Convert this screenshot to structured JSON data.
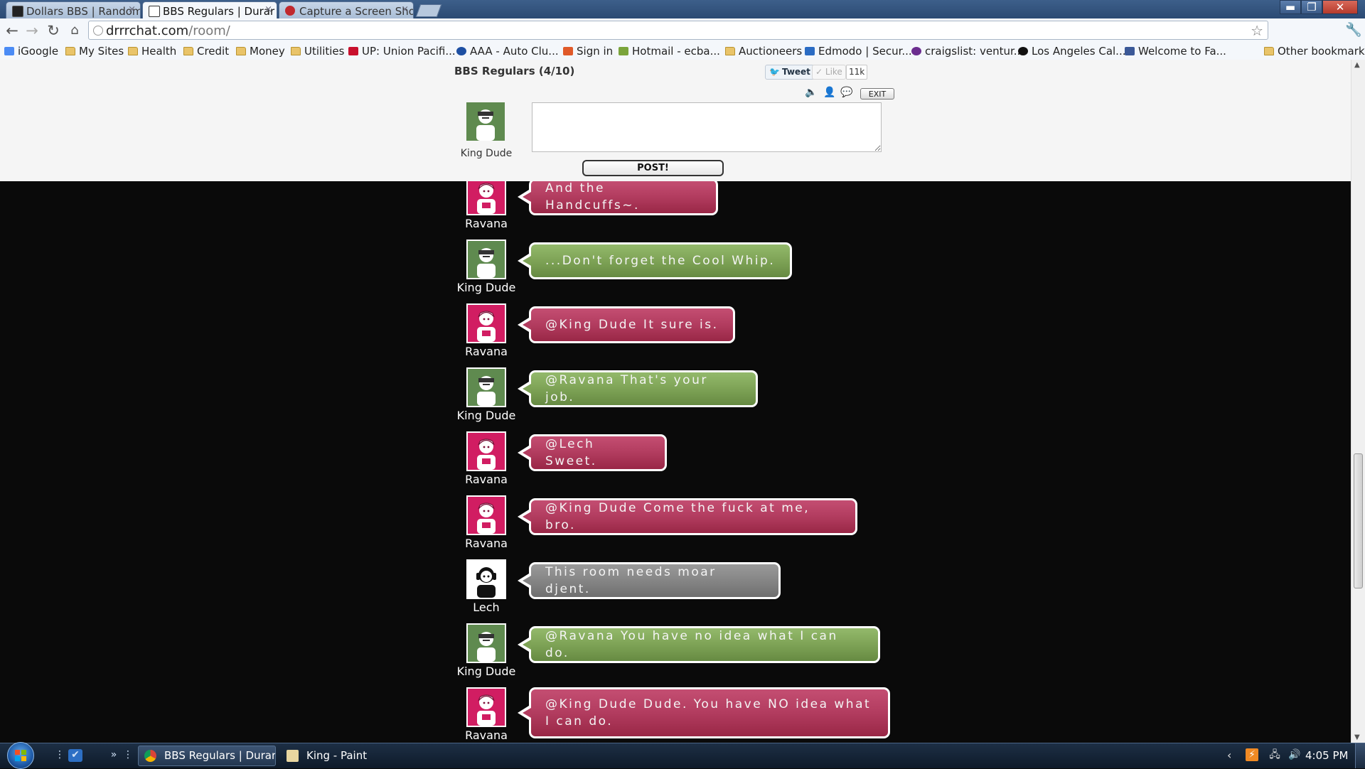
{
  "browser": {
    "tabs": [
      {
        "label": "Dollars BBS | Random",
        "icon_color": "#222222"
      },
      {
        "label": "BBS Regulars | Durar",
        "icon_color": "#333333"
      },
      {
        "label": "Capture a Screen Sho",
        "icon_color": "#c0282d"
      }
    ],
    "url_host": "drrrchat.com",
    "url_path": "/room/",
    "window_controls": {
      "minimize": "▬",
      "restore": "❐",
      "close": "✕"
    },
    "icons": {
      "back": "back-arrow-icon",
      "forward": "forward-arrow-icon",
      "reload": "reload-icon",
      "home": "home-icon",
      "star": "star-icon",
      "wrench": "wrench-icon"
    }
  },
  "bookmarks": [
    {
      "label": "iGoogle",
      "icon": "igoogle-icon",
      "color": "#4a8bf5"
    },
    {
      "label": "My Sites",
      "icon": "folder-icon",
      "color": "#e9c46a"
    },
    {
      "label": "Health",
      "icon": "folder-icon",
      "color": "#e9c46a"
    },
    {
      "label": "Credit",
      "icon": "folder-icon",
      "color": "#e9c46a"
    },
    {
      "label": "Money",
      "icon": "folder-icon",
      "color": "#e9c46a"
    },
    {
      "label": "Utilities",
      "icon": "folder-icon",
      "color": "#e9c46a"
    },
    {
      "label": "UP: Union Pacifi...",
      "icon": "union-pacific-icon",
      "color": "#c8102e"
    },
    {
      "label": "AAA - Auto Clu...",
      "icon": "aaa-icon",
      "color": "#1d4fa3"
    },
    {
      "label": "Sign in",
      "icon": "msn-icon",
      "color": "#e05a2a"
    },
    {
      "label": "Hotmail - ecba...",
      "icon": "hotmail-icon",
      "color": "#7aa43c"
    },
    {
      "label": "Auctioneers",
      "icon": "folder-icon",
      "color": "#e9c46a"
    },
    {
      "label": "Edmodo | Secur...",
      "icon": "edmodo-icon",
      "color": "#2b6cc4"
    },
    {
      "label": "craigslist: ventur...",
      "icon": "peace-icon",
      "color": "#6b2d8f"
    },
    {
      "label": "Los Angeles Cal...",
      "icon": "la-icon",
      "color": "#111111"
    },
    {
      "label": "Welcome to Fa...",
      "icon": "facebook-icon",
      "color": "#3b5998"
    }
  ],
  "other_bookmarks": "Other bookmarks",
  "room": {
    "title": "BBS Regulars (4/10)",
    "tweet_label": "Tweet",
    "like_label": "Like",
    "like_count": "11k",
    "exit_label": "EXIT",
    "post_label": "POST!",
    "current_user": "King Dude",
    "post_text": "",
    "controls": [
      "speaker-icon",
      "user-icon",
      "speech-bubble-icon"
    ]
  },
  "user_colors": {
    "King Dude": "#5f8a4f",
    "Ravana": "#d11d62",
    "Lech": "#ffffff"
  },
  "messages": [
    {
      "user": "Ravana",
      "text": "And the Handcuffs~.",
      "color": "pink"
    },
    {
      "user": "King Dude",
      "text": "...Don't forget the Cool Whip.",
      "color": "green"
    },
    {
      "user": "Ravana",
      "text": "@King Dude It sure is.",
      "color": "pink"
    },
    {
      "user": "King Dude",
      "text": "@Ravana That's your job.",
      "color": "green"
    },
    {
      "user": "Ravana",
      "text": "@Lech Sweet.",
      "color": "pink"
    },
    {
      "user": "Ravana",
      "text": "@King Dude Come the fuck at me, bro.",
      "color": "pink"
    },
    {
      "user": "Lech",
      "text": "This room needs moar djent.",
      "color": "gray"
    },
    {
      "user": "King Dude",
      "text": "@Ravana You have no idea what I can do.",
      "color": "green"
    },
    {
      "user": "Ravana",
      "text": "@King Dude Dude. You have NO idea what I can do.",
      "color": "pink"
    }
  ],
  "taskbar": {
    "tasks": [
      {
        "label": "BBS Regulars | Durar...",
        "icon": "chrome-icon"
      },
      {
        "label": "King - Paint",
        "icon": "paint-icon"
      }
    ],
    "clock": "4:05 PM"
  }
}
